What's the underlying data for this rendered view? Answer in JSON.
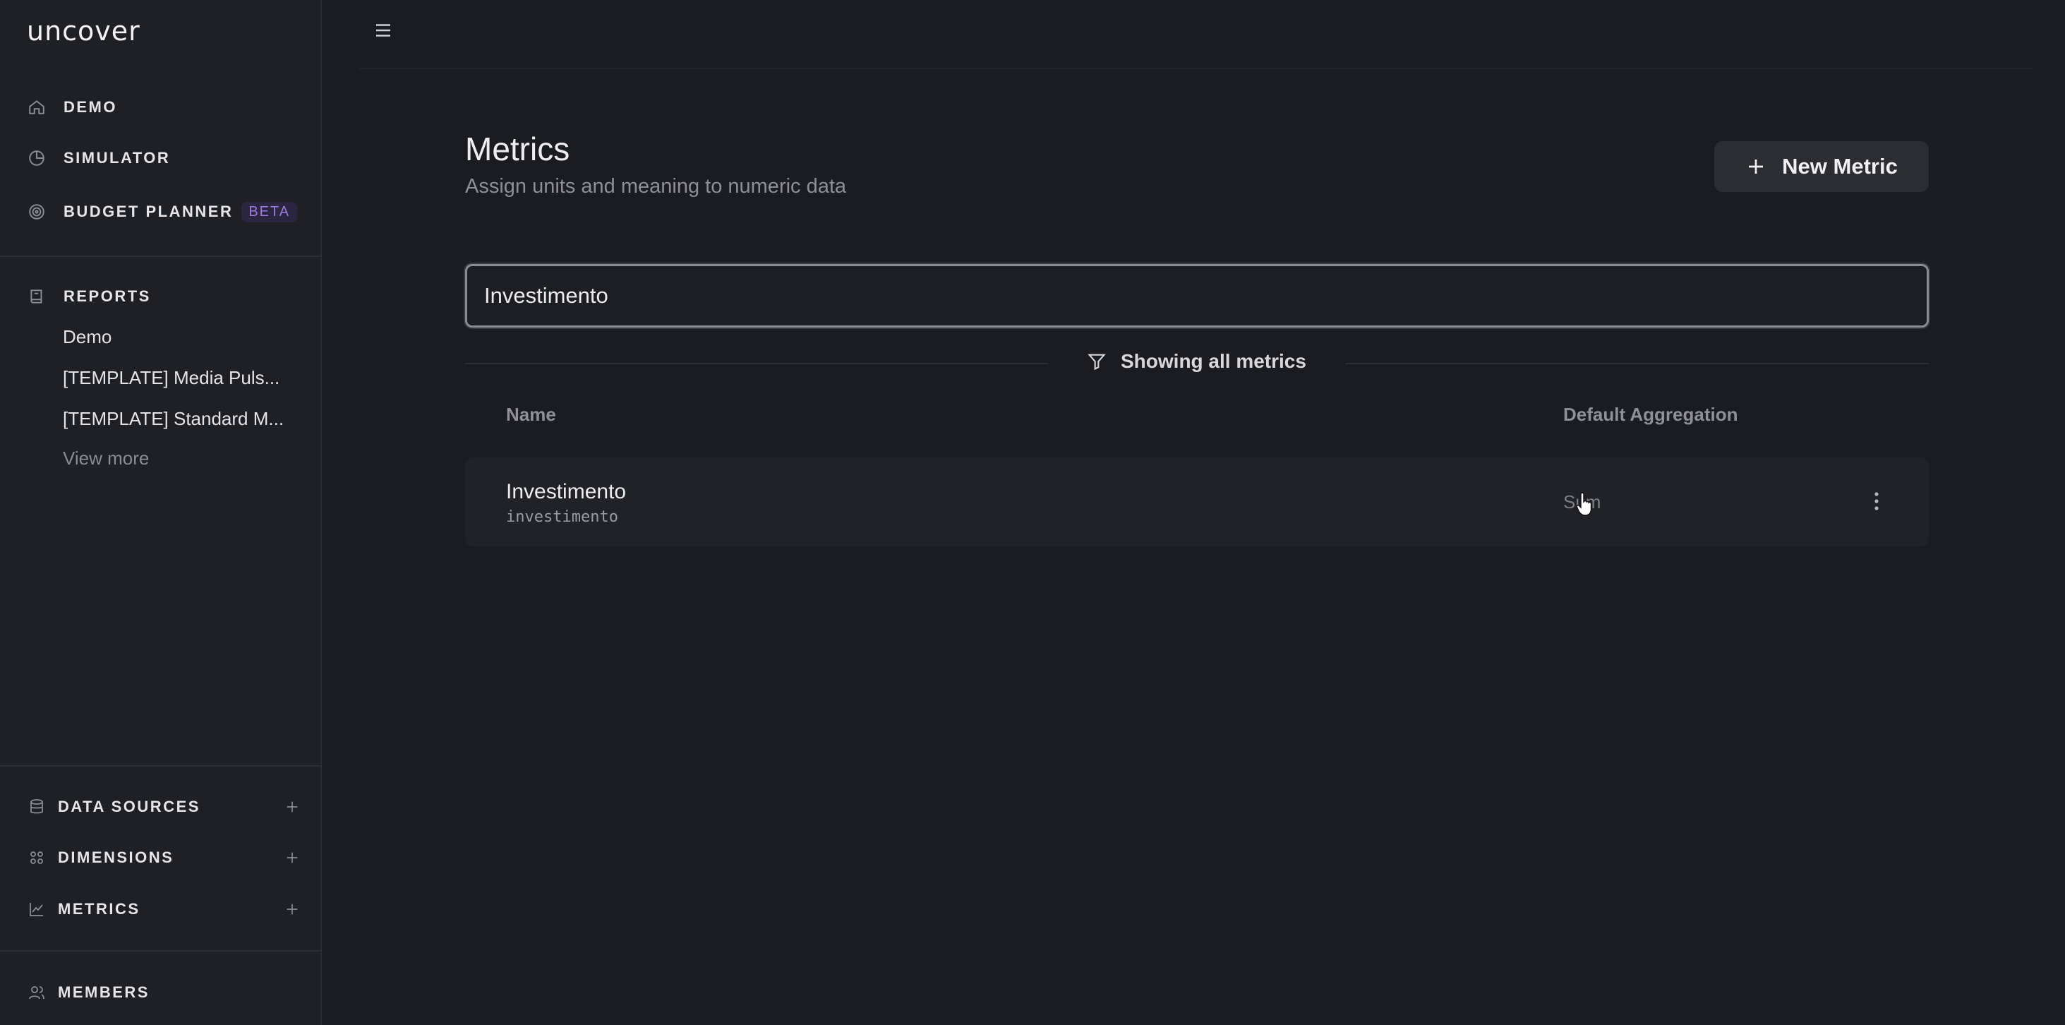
{
  "app": {
    "logo": "uncover"
  },
  "sidebar": {
    "nav": [
      {
        "label": "DEMO",
        "icon": "home-icon"
      },
      {
        "label": "SIMULATOR",
        "icon": "pie-chart-icon"
      },
      {
        "label": "BUDGET PLANNER",
        "icon": "target-icon",
        "badge": "BETA"
      }
    ],
    "reports": {
      "label": "REPORTS",
      "icon": "book-icon",
      "items": [
        "Demo",
        "[TEMPLATE] Media Puls...",
        "[TEMPLATE] Standard M..."
      ],
      "view_more": "View more"
    },
    "sections": [
      {
        "label": "DATA SOURCES",
        "icon": "database-icon"
      },
      {
        "label": "DIMENSIONS",
        "icon": "grid-icon"
      },
      {
        "label": "METRICS",
        "icon": "line-chart-icon"
      }
    ],
    "members": {
      "label": "MEMBERS",
      "icon": "users-icon"
    }
  },
  "header": {
    "title": "Metrics",
    "subtitle": "Assign units and meaning to numeric data",
    "new_button": "New Metric"
  },
  "search": {
    "value": "Investimento",
    "placeholder": ""
  },
  "filter": {
    "label": "Showing all metrics"
  },
  "table": {
    "columns": [
      "Name",
      "Default Aggregation"
    ],
    "rows": [
      {
        "name": "Investimento",
        "id": "investimento",
        "aggregation": "Sum"
      }
    ]
  },
  "colors": {
    "background": "#1b1c21",
    "sidebar": "#1f2025",
    "accent_beta": "#9d7ae0"
  }
}
